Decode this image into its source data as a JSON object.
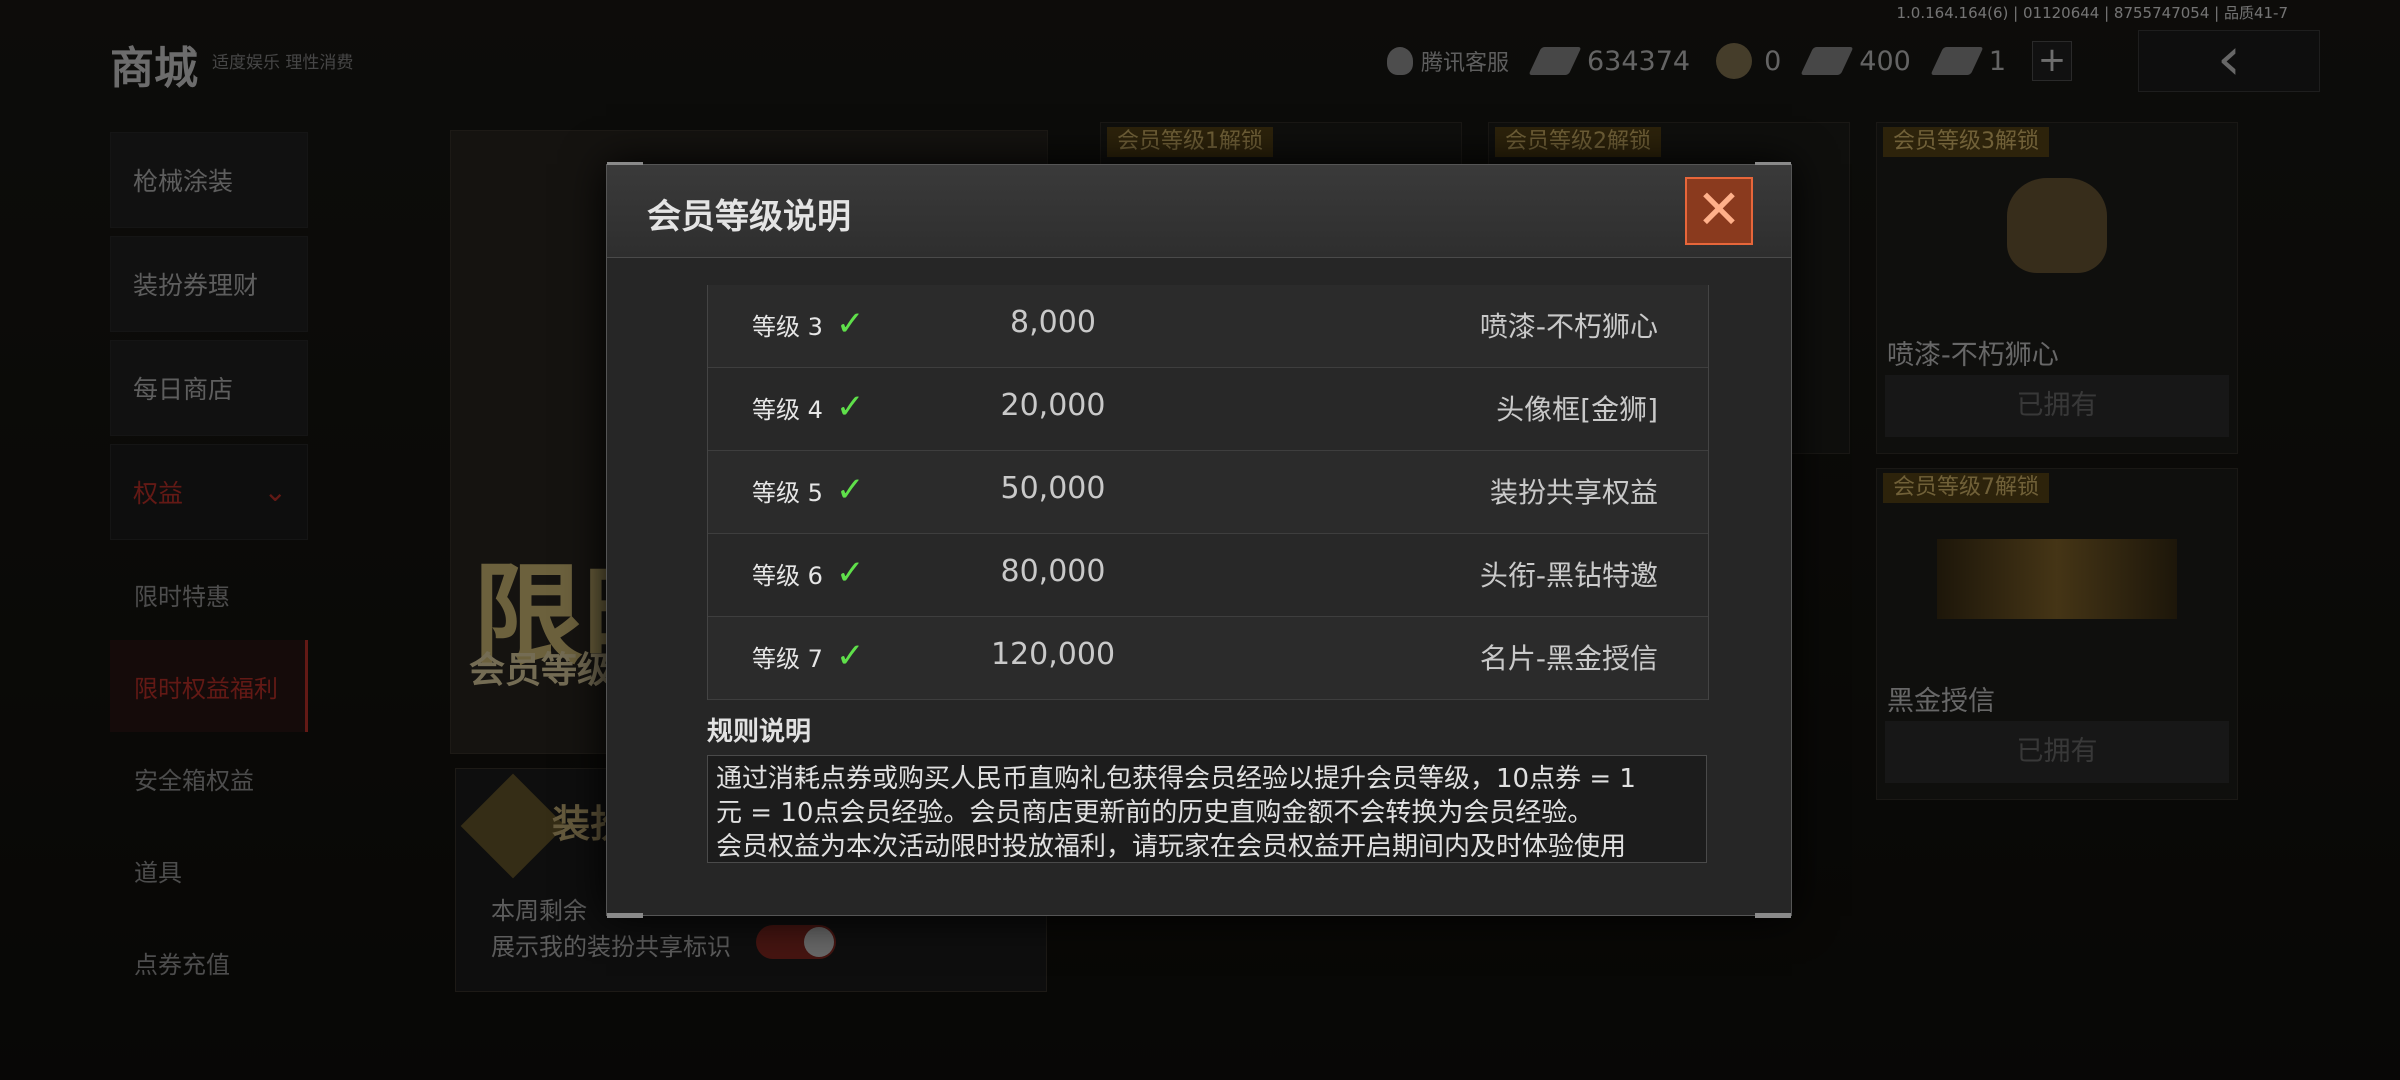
{
  "version": "1.0.164.164(6) | 01120644 | 8755747054 | 品质41-7",
  "header": {
    "title": "商城",
    "subtitle": "适度娱乐 理性消费",
    "customer_service": "腾讯客服",
    "currencies": [
      {
        "icon": "voucher-icon",
        "value": "634374"
      },
      {
        "icon": "coin-icon",
        "value": "0"
      },
      {
        "icon": "ticket-icon",
        "value": "400"
      },
      {
        "icon": "card-icon",
        "value": "1"
      }
    ],
    "plus_label": "+",
    "back_label": "‹"
  },
  "sidebar": {
    "items": [
      {
        "label": "枪械涂装"
      },
      {
        "label": "装扮券理财"
      },
      {
        "label": "每日商店"
      },
      {
        "label": "权益"
      }
    ],
    "sub_items": [
      {
        "label": "限时特惠"
      },
      {
        "label": "限时权益福利"
      },
      {
        "label": "安全箱权益"
      },
      {
        "label": "道具"
      },
      {
        "label": "点券充值"
      }
    ]
  },
  "background": {
    "banner_big": "限时",
    "banner_line": "会员等级",
    "card2_title": "装扮",
    "card2_line1": "本周剩余",
    "card2_line2": "展示我的装扮共享标识",
    "goods": [
      {
        "badge": "会员等级1解锁",
        "name": "",
        "owned": ""
      },
      {
        "badge": "会员等级2解锁",
        "name": "",
        "owned": ""
      },
      {
        "badge": "会员等级3解锁",
        "name": "喷漆-不朽狮心",
        "owned": "已拥有"
      },
      {
        "badge": "会员等级7解锁",
        "name": "黑金授信",
        "owned": "已拥有"
      }
    ]
  },
  "modal": {
    "title": "会员等级说明",
    "close_label": "✕",
    "rows": [
      {
        "level": "等级 3",
        "exp": "8,000",
        "reward": "喷漆-不朽狮心"
      },
      {
        "level": "等级 4",
        "exp": "20,000",
        "reward": "头像框[金狮]"
      },
      {
        "level": "等级 5",
        "exp": "50,000",
        "reward": "装扮共享权益"
      },
      {
        "level": "等级 6",
        "exp": "80,000",
        "reward": "头衔-黑钻特邀"
      },
      {
        "level": "等级 7",
        "exp": "120,000",
        "reward": "名片-黑金授信"
      }
    ],
    "check_glyph": "✓",
    "rules_title": "规则说明",
    "rules_lines": [
      "通过消耗点券或购买人民币直购礼包获得会员经验以提升会员等级，10点券 = 1",
      "元 = 10点会员经验。会员商店更新前的历史直购金额不会转换为会员经验。",
      "会员权益为本次活动限时投放福利，请玩家在会员权益开启期间内及时体验使用"
    ]
  }
}
